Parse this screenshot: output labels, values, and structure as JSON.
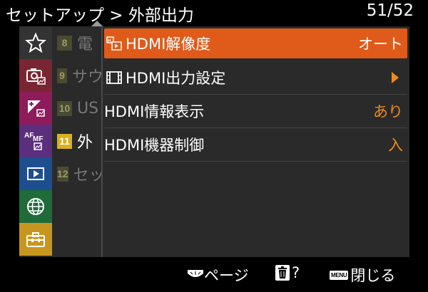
{
  "header": {
    "title": "セットアップ > 外部出力",
    "page": "51/52"
  },
  "categories": [
    {
      "icon": "star-icon",
      "color": "#333333"
    },
    {
      "icon": "camera-icon",
      "color": "#7a2532"
    },
    {
      "icon": "exposure-icon",
      "color": "#8e1b5a"
    },
    {
      "icon": "af-mf-icon",
      "color": "#5c2f7e"
    },
    {
      "icon": "playback-icon",
      "color": "#1d4e8f"
    },
    {
      "icon": "network-icon",
      "color": "#1f6b3a"
    },
    {
      "icon": "toolbox-icon",
      "color": "#c8961e"
    }
  ],
  "subtabs": [
    {
      "num": "8",
      "text": "電",
      "active": false
    },
    {
      "num": "9",
      "text": "サウ",
      "active": false
    },
    {
      "num": "10",
      "text": "US",
      "active": false
    },
    {
      "num": "11",
      "text": "外",
      "active": true
    },
    {
      "num": "12",
      "text": "セッ",
      "active": false
    }
  ],
  "menu_items": [
    {
      "icon": "resolution-icon",
      "label": "HDMI解像度",
      "value": "オート",
      "selected": true
    },
    {
      "icon": "film-icon",
      "label": "HDMI出力設定",
      "value": "",
      "has_arrow": true,
      "selected": false
    },
    {
      "icon": "",
      "label": "HDMI情報表示",
      "value": "あり",
      "selected": false
    },
    {
      "icon": "",
      "label": "HDMI機器制御",
      "value": "入",
      "selected": false
    }
  ],
  "footer": {
    "page_label": "ページ",
    "help_label": "?",
    "menu_key": "MENU",
    "close_label": "閉じる"
  },
  "colors": {
    "selected_bg": "#e05a1a",
    "value_orange": "#f08a1e",
    "active_subtab": "#d8b020",
    "inactive_subtab": "#4a4a30",
    "panel_bg": "#2a2a2a"
  }
}
